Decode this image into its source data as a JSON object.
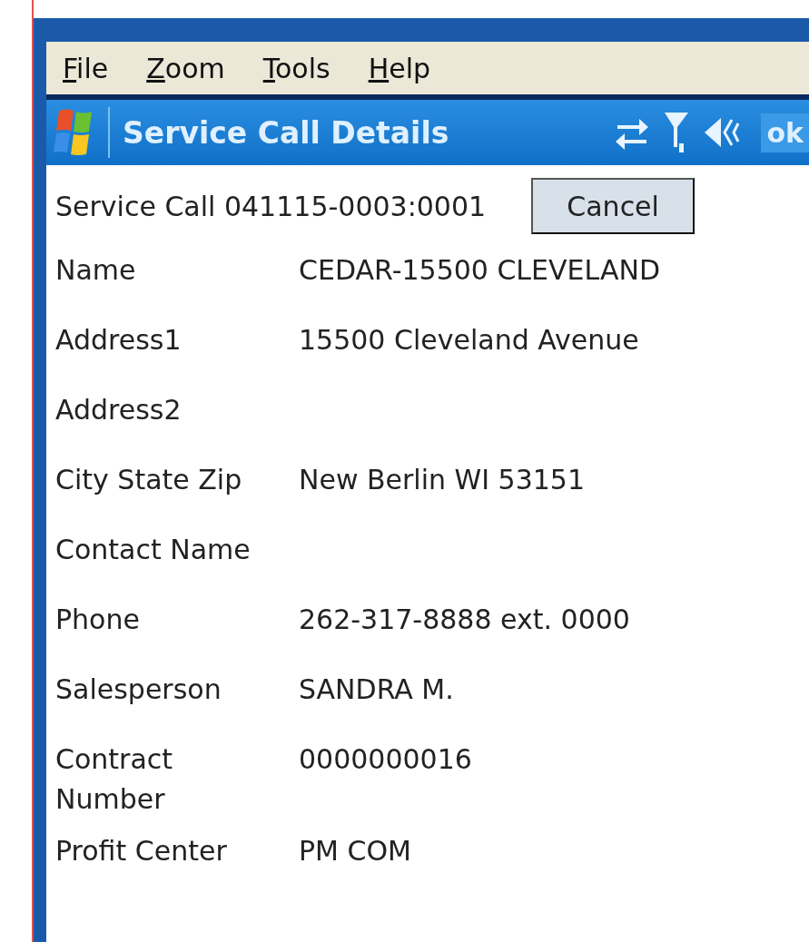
{
  "menu": [
    "File",
    "Zoom",
    "Tools",
    "Help"
  ],
  "title_bar": {
    "title": "Service Call Details",
    "ok": "ok"
  },
  "header": {
    "text": "Service Call 041115-0003:0001",
    "cancel": "Cancel"
  },
  "fields": [
    {
      "label": "Name",
      "value": "CEDAR-15500 CLEVELAND"
    },
    {
      "label": "Address1",
      "value": "15500 Cleveland Avenue"
    },
    {
      "label": "Address2"
    },
    {
      "label": "City State Zip",
      "value": "New Berlin WI 53151"
    },
    {
      "label": "Contact Name"
    },
    {
      "label": "Phone",
      "value": "262-317-8888 ext. 0000"
    },
    {
      "label": "Salesperson",
      "value": "SANDRA M."
    },
    {
      "label": "Contract Number",
      "value": "0000000016"
    },
    {
      "label": "Profit Center",
      "value": "PM COM"
    }
  ]
}
